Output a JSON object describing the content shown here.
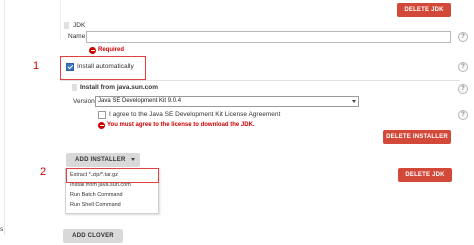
{
  "jdk_section": {
    "delete_jdk_top_label": "DELETE JDK",
    "title": "JDK",
    "name_label": "Name",
    "name_value": "",
    "required_text": "Required",
    "install_auto_label": "Install automatically",
    "install_auto_checked": true,
    "delete_jdk_bottom_label": "DELETE JDK"
  },
  "installer": {
    "title": "Install from java.sun.com",
    "version_label": "Version",
    "version_selected": "Java SE Development Kit 9.0.4",
    "license_label": "I agree to the Java SE Development Kit License Agreement",
    "license_checked": false,
    "license_error": "You must agree to the license to download the JDK.",
    "delete_installer_label": "DELETE INSTALLER"
  },
  "add_installer": {
    "button_label": "ADD INSTALLER",
    "menu_items": [
      "Extract *.zip/*.tar.gz",
      "Install from java.sun.com",
      "Run Batch Command",
      "Run Shell Command"
    ]
  },
  "footer": {
    "add_clover_label": "ADD CLOVER",
    "edge_text": "s"
  },
  "annotations": {
    "marker_1": "1",
    "marker_2": "2",
    "color": "#cc0000"
  },
  "help_glyph": "?",
  "colors": {
    "delete_button": "#d24939",
    "neutral_button": "#d9d9d9",
    "error": "#cc0000",
    "checkbox_checked": "#3a76c4"
  }
}
